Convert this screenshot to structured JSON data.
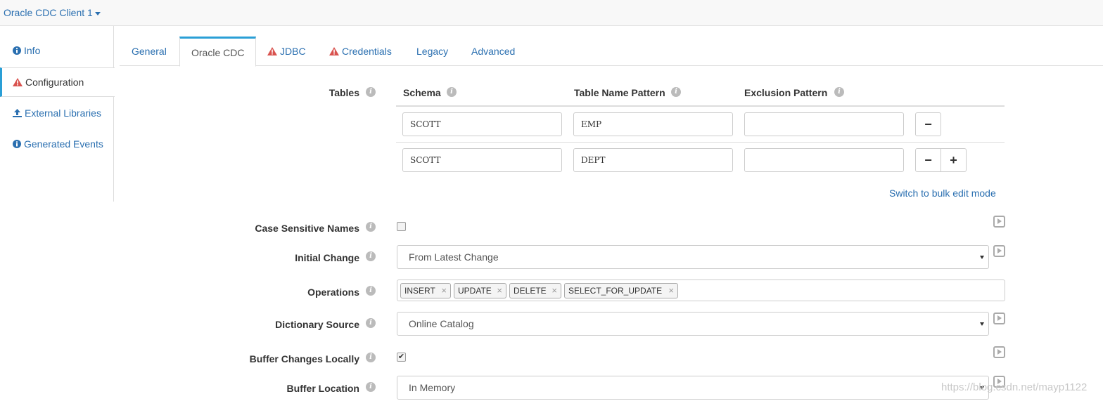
{
  "header": {
    "title": "Oracle CDC Client 1"
  },
  "sidebar": {
    "items": [
      {
        "label": "Info",
        "icon": "info-circle-icon"
      },
      {
        "label": "Configuration",
        "icon": "warning-icon"
      },
      {
        "label": "External Libraries",
        "icon": "upload-icon"
      },
      {
        "label": "Generated Events",
        "icon": "info-circle-icon"
      }
    ]
  },
  "tabs": [
    {
      "label": "General"
    },
    {
      "label": "Oracle CDC"
    },
    {
      "label": "JDBC",
      "icon": "warning-icon"
    },
    {
      "label": "Credentials",
      "icon": "warning-icon"
    },
    {
      "label": "Legacy"
    },
    {
      "label": "Advanced"
    }
  ],
  "tables": {
    "label": "Tables",
    "columns": [
      "Schema",
      "Table Name Pattern",
      "Exclusion Pattern"
    ],
    "rows": [
      {
        "schema": "SCOTT",
        "pattern": "EMP",
        "exclusion": ""
      },
      {
        "schema": "SCOTT",
        "pattern": "DEPT",
        "exclusion": ""
      }
    ],
    "remove_label": "−",
    "add_label": "+",
    "bulk_edit_link": "Switch to bulk edit mode"
  },
  "fields": {
    "case_sensitive": {
      "label": "Case Sensitive Names",
      "checked": false
    },
    "initial_change": {
      "label": "Initial Change",
      "value": "From Latest Change"
    },
    "operations": {
      "label": "Operations",
      "tags": [
        "INSERT",
        "UPDATE",
        "DELETE",
        "SELECT_FOR_UPDATE"
      ],
      "remove_glyph": "×"
    },
    "dictionary_source": {
      "label": "Dictionary Source",
      "value": "Online Catalog"
    },
    "buffer_changes": {
      "label": "Buffer Changes Locally",
      "checked": true,
      "check_glyph": "✔"
    },
    "buffer_location": {
      "label": "Buffer Location",
      "value": "In Memory"
    }
  },
  "info_glyph": "i",
  "watermark": "https://blog.csdn.net/mayp1122",
  "colors": {
    "link": "#2a6fb0",
    "accent": "#2a9fd6",
    "warning": "#d9534f"
  }
}
